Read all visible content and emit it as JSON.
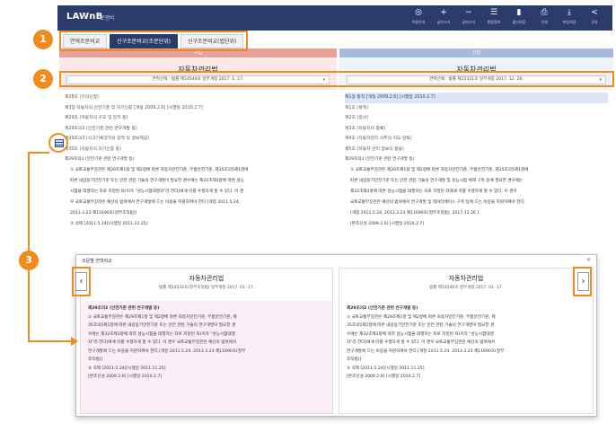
{
  "app": {
    "brand": "LAWnB",
    "brand_sub": "로앤비"
  },
  "toolbar": [
    {
      "icon": "target-icon",
      "glyph": "◎",
      "label": "이용안내"
    },
    {
      "icon": "zoom-in-icon",
      "glyph": "+",
      "label": "글자크기"
    },
    {
      "icon": "zoom-out-icon",
      "glyph": "−",
      "label": "글자크기"
    },
    {
      "icon": "list-icon",
      "glyph": "☰",
      "label": "법령정보"
    },
    {
      "icon": "folder-icon",
      "glyph": "▮",
      "label": "폴더저장"
    },
    {
      "icon": "print-icon",
      "glyph": "⎙",
      "label": "인쇄"
    },
    {
      "icon": "download-icon",
      "glyph": "⤓",
      "label": "파일저장"
    },
    {
      "icon": "share-icon",
      "glyph": "<",
      "label": "공유"
    }
  ],
  "tabs": [
    {
      "label": "연혁조문비교",
      "active": false
    },
    {
      "label": "신구조문비교(조문단위)",
      "active": true
    },
    {
      "label": "신구조문비교(법단위)",
      "active": false
    }
  ],
  "left_pane": {
    "header": "구법",
    "title": "자동차관리법",
    "version": "연혁선택 : 법률 제14548호 일부개정 2017. 1. 17.",
    "articles": [
      {
        "text": "제28조 (이의신청)",
        "hl": false
      },
      {
        "text": "제3장 자동차의 안전기준 및 자기인증 [개정 2009.2.6] [시행일 2010.2.7]",
        "hl": false
      },
      {
        "text": "제29조 (자동차의 구조 및 장치 등)",
        "hl": false
      },
      {
        "text": "제29조의2 (안전기준 관련 연구개발 등)",
        "hl": false
      },
      {
        "text": "제29조의3 (사고기록장치의 장착 및 정보제공)",
        "hl": false
      },
      {
        "text": "제30조 (자동차의 자기인증 등)",
        "hl": false
      }
    ],
    "selected": {
      "title": "제29조의2 (안전기준 관련 연구개발 등)",
      "lines": [
        "① 국토교통부장관은 제29조제1항 및 제2항에 따른 자동차안전기준, 부품안전기준, 제35조의5제1항에",
        "따른 내압용기안전기준 또는 안전 관련 기술의 연구개발이 필요한 경우에는 제32조제3항에 따른 성능",
        "시험을 대행하는 자로 지정된 자(이하 \"성능시험대행자\"라 한다)에게 이를 수행하게 할 수 있다. 이 경",
        "우 국토교통부장관은 예산의 범위에서 연구개발에 드는 비용을 지원하여야 한다.[개정 2011.5.24,",
        "2013.3.23 제11690호(정부조직법)]",
        "② 삭제 [2011.5.24][시행일 2011.11.25]"
      ]
    }
  },
  "right_pane": {
    "header": "신법",
    "title": "자동차관리법",
    "version": "연혁선택 : 법률 제15321호 일부개정 2017. 12. 26.",
    "articles": [
      {
        "text": "제1장 총칙 [개정 2009.2.6] [시행일 2010.2.7]",
        "hl": true
      },
      {
        "text": "제1조 (목적)",
        "hl": false
      },
      {
        "text": "제2조 (정의)",
        "hl": false
      },
      {
        "text": "제3조 (자동차의 종류)",
        "hl": false
      },
      {
        "text": "제4조 (자동차관리 사무의 지도·감독)",
        "hl": false
      },
      {
        "text": "제5조 (자동차 관리 정보의 활용)",
        "hl": false
      }
    ],
    "selected": {
      "title": "제29조의2 (안전기준 관련 연구개발 등)",
      "lines": [
        "① 국토교통부장관은 제29조제1항 및 제2항에 따른 자동차안전기준, 부품안전기준, 제35조의5제1항에",
        "따른 내압용기안전기준 또는 안전 관련 기술의 연구개발 및 성능시험 체계 구축 등에 필요한 경우에는",
        "제32조제3항에 따른 성능시험을 대행하는 자로 지정된 자에게 이를 수행하게 할 수 있다. 이 경우",
        "국토교통부장관은 예산의 범위에서 연구개발 및 데이터베이스 구축 등에 드는 비용을 지원하여야 한다.",
        "[개정 2011.5.24, 2013.3.23 제11690호(정부조직법), 2017.12.26 ]",
        "[본조신설 2009.2.6] [시행일 2010.2.7]"
      ]
    }
  },
  "popup": {
    "title": "조문별 연혁비교",
    "close": "×",
    "prev": "‹",
    "next": "›",
    "left": {
      "title": "자동차관리법",
      "version": "법률 제14532호(정부조직법) 일부개정 2017. 01. 17.",
      "lines": [
        "제29조의2 (안전기준 관련 연구개발 등)",
        "① 국토교통부장관은 제29조제1항 및 제2항에 따른 자동차안전기준, 부품안전기준, 제",
        "35조의5제1항에 따른 내압용기안전기준 또는 안전 관련 기술의 연구개발이 필요한 경",
        "우에는 제32조제3항에 따라 성능시험을 대행하는 자로 지정된 자(이하 \"성능시험대행",
        "자\"라 한다)에게 이를 수행하게 할 수 있다. 이 경우 국토교통부장관은 예산의 범위에서",
        "연구개발에 드는 비용을 지원하여야 한다.[개정 2011.5.24, 2013.3.23 제11690호(정부",
        "조직법)]",
        "② 삭제 [2011.5.24][시행일 2011.11.25]",
        "[본조신설 2009.2.6] [시행일 2010.2.7]"
      ]
    },
    "right": {
      "title": "자동차관리법",
      "version": "법률 제14546호 일부개정 2017. 01. 17.",
      "lines": [
        "제29조의2 (안전기준 관련 연구개발 등)",
        "① 국토교통부장관은 제29조제1항 및 제2항에 따른 자동차안전기준, 부품안전기준, 제",
        "35조의5제1항에 따른 내압용기안전기준 또는 안전 관련 기술의 연구개발이 필요한 경",
        "우에는 제32조제3항에 따라 성능시험을 대행하는 자로 지정된 자(이하 \"성능시험대행",
        "자\"라 한다)에게 이를 수행하게 할 수 있다. 이 경우 국토교통부장관은 예산의 범위에서",
        "연구개발에 드는 비용을 지원하여야 한다.[개정 2011.5.24, 2013.3.23 제11690호(정부",
        "조직법)]",
        "② 삭제 [2011.5.24][시행일 2011.11.25]",
        "[본조신설 2009.2.6] [시행일 2010.2.7]"
      ]
    }
  },
  "callouts": [
    "1",
    "2",
    "3"
  ],
  "colors": {
    "accent": "#f08c1e",
    "navy": "#2b3b6b",
    "old": "#e7a19b",
    "new": "#a9b9d9"
  }
}
